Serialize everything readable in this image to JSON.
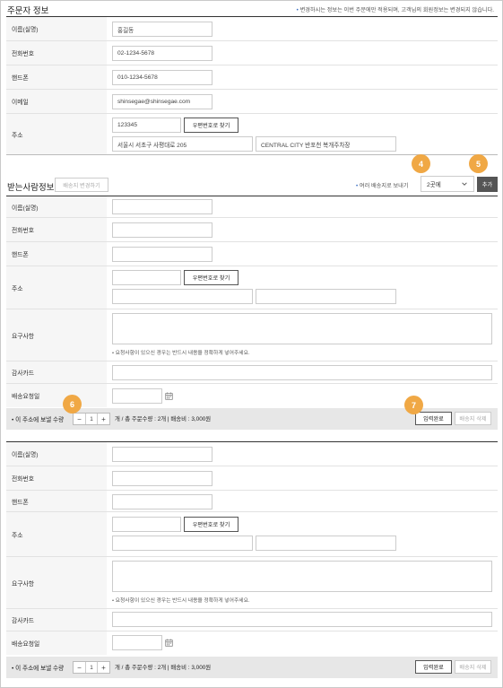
{
  "orderer": {
    "title": "주문자 정보",
    "notice": "변경하시는 정보는 이번 주문에만 적용되며, 고객님의 회원정보는 변경되지 않습니다.",
    "fields": {
      "name_label": "이름(실명)",
      "name_value": "홍길동",
      "phone_label": "전화번호",
      "phone_value": "02-1234-5678",
      "mobile_label": "핸드폰",
      "mobile_value": "010-1234-5678",
      "email_label": "이메일",
      "email_value": "shinsegae@shinsegae.com",
      "address_label": "주소",
      "zip_value": "123345",
      "zip_button": "우편번호로 찾기",
      "addr1_value": "서울시 서초구 사평대로 205",
      "addr2_value": "CENTRAL CITY 반포천 복개주차장"
    }
  },
  "receiver": {
    "title": "받는사람정보",
    "change_button": "배송지 변경하기",
    "multi_link": "여러 배송지로 보내기",
    "count_select": "2곳에",
    "add_button": "추가",
    "badges": {
      "b4": "4",
      "b5": "5",
      "b6": "6",
      "b7": "7"
    },
    "blocks": [
      {
        "name_label": "이름(실명)",
        "phone_label": "전화번호",
        "mobile_label": "핸드폰",
        "address_label": "주소",
        "zip_button": "우편번호로 찾기",
        "request_label": "요구사항",
        "request_hint": "요청사항이 있으신 경우는 반드시 내용을 정확하게 넣어주세요.",
        "gift_label": "감사카드",
        "date_label": "배송요청일",
        "qty_label": "이 주소에 보낼 수량",
        "qty_minus": "−",
        "qty_value": "1",
        "qty_plus": "+",
        "qty_summary": "개  / 총 주문수량 : 2개  | 배송비 : 3,000원",
        "confirm_button": "입력완료",
        "delete_button": "배송지 삭제"
      },
      {
        "name_label": "이름(실명)",
        "phone_label": "전화번호",
        "mobile_label": "핸드폰",
        "address_label": "주소",
        "zip_button": "우편번호로 찾기",
        "request_label": "요구사항",
        "request_hint": "요청사항이 있으신 경우는 반드시 내용을 정확하게 넣어주세요.",
        "gift_label": "감사카드",
        "date_label": "배송요청일",
        "qty_label": "이 주소에 보낼 수량",
        "qty_minus": "−",
        "qty_value": "1",
        "qty_plus": "+",
        "qty_summary": "개  / 총 주문수량 : 2개  | 배송비 : 3,000원",
        "confirm_button": "입력완료",
        "delete_button": "배송지 삭제"
      }
    ]
  },
  "colors": {
    "badge": "#f0a845",
    "accent_dot": "#3a6fc4",
    "bar_bg": "#e7e7e7",
    "label_bg": "#f6f6f6"
  }
}
